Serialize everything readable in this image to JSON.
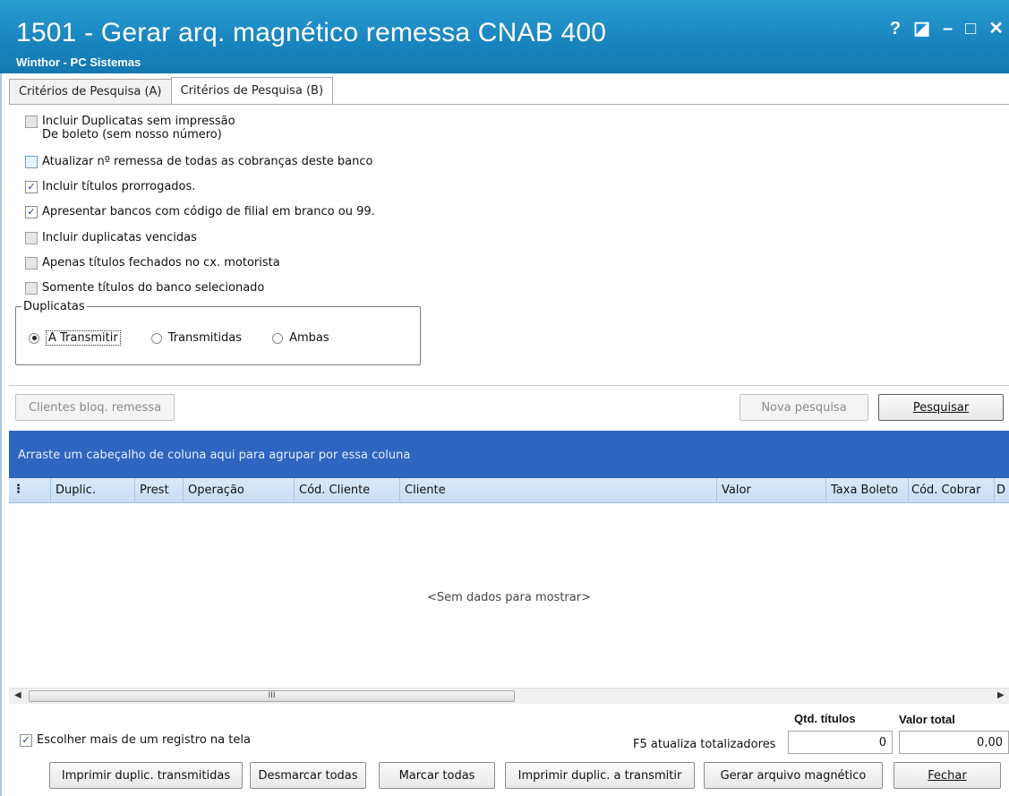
{
  "window": {
    "title": "1501 - Gerar arq. magnético remessa CNAB 400",
    "subtitle": "Winthor - PC Sistemas",
    "controls": {
      "help": "?",
      "restore": "◪",
      "minimize": "–",
      "maximize": "□",
      "close": "✕"
    }
  },
  "tabs": [
    "Critérios de Pesquisa (A)",
    "Critérios de Pesquisa (B)"
  ],
  "options": [
    {
      "label": "Incluir Duplicatas sem impressão",
      "label2": "De boleto (sem nosso número)",
      "checked": false
    },
    {
      "label": "Atualizar nº remessa de todas as cobranças deste banco",
      "checked": false
    },
    {
      "label": "Incluir títulos prorrogados.",
      "checked": true
    },
    {
      "label": "Apresentar bancos com código de filial em branco ou 99.",
      "checked": true
    },
    {
      "label": "Incluir duplicatas vencidas",
      "checked": false
    },
    {
      "label": "Apenas títulos fechados no cx. motorista",
      "checked": false
    },
    {
      "label": "Somente títulos do banco selecionado",
      "checked": false
    }
  ],
  "duplicatas": {
    "legend": "Duplicatas",
    "options": [
      "A Transmitir",
      "Transmitidas",
      "Ambas"
    ],
    "selected": "A Transmitir"
  },
  "buttons": {
    "clientes_bloq": "Clientes bloq. remessa",
    "nova_pesquisa": "Nova pesquisa",
    "pesquisar": "Pesquisar"
  },
  "grid": {
    "group_hint": "Arraste um cabeçalho de coluna aqui para agrupar por essa coluna",
    "columns": [
      "Duplic.",
      "Prest",
      "Operação",
      "Cód. Cliente",
      "Cliente",
      "Valor",
      "Taxa Boleto",
      "Cód. Cobrar",
      "D"
    ],
    "empty_text": "<Sem dados para mostrar>",
    "scroll_thumb": "III"
  },
  "footer": {
    "multi_select_label": "Escolher mais de um registro na tela",
    "multi_select_checked": true,
    "qtd_titulos_label": "Qtd. títulos",
    "valor_total_label": "Valor total",
    "f5_hint": "F5 atualiza totalizadores",
    "qtd_titulos": "0",
    "valor_total": "0,00"
  },
  "actions": {
    "imprimir_transmitidas": "Imprimir duplic. transmitidas",
    "desmarcar_todas": "Desmarcar todas",
    "marcar_todas": "Marcar todas",
    "imprimir_a_transmitir": "Imprimir duplic. a transmitir",
    "gerar_arquivo": "Gerar arquivo magnético",
    "fechar": "Fechar"
  }
}
